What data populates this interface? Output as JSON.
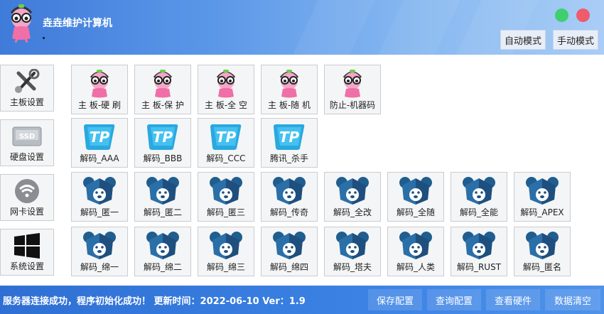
{
  "header": {
    "title": "垚垚维护计算机",
    "auto_mode_label": "自动模式",
    "manual_mode_label": "手动模式",
    "close_color": "#ef5a6d",
    "min_color": "#3fcf6f"
  },
  "sidebar": {
    "items": [
      {
        "label": "主板设置",
        "icon": "tools-icon"
      },
      {
        "label": "硬盘设置",
        "icon": "ssd-icon"
      },
      {
        "label": "网卡设置",
        "icon": "wifi-icon"
      },
      {
        "label": "系统设置",
        "icon": "windows-icon"
      }
    ]
  },
  "rows": [
    {
      "icon": "mascot-icon",
      "tiles": [
        "主 板-硬 刷",
        "主 板-保 护",
        "主 板-全 空",
        "主 板-随 机",
        "防止-机器码"
      ]
    },
    {
      "icon": "tp-icon",
      "tiles": [
        "解码_AAA",
        "解码_BBB",
        "解码_CCC",
        "腾讯_杀手"
      ]
    },
    {
      "icon": "bear-icon",
      "tiles": [
        "解码_匿一",
        "解码_匿二",
        "解码_匿三",
        "解码_传奇",
        "解码_全改",
        "解码_全随",
        "解码_全能",
        "解码_APEX"
      ]
    },
    {
      "icon": "bear-icon",
      "tiles": [
        "解码_绵一",
        "解码_绵二",
        "解码_绵三",
        "解码_绵四",
        "解码_塔夫",
        "解码_人类",
        "解码_RUST",
        "解码_匿名"
      ]
    }
  ],
  "status": {
    "text": "服务器连接成功，程序初始化成功！  更新时间：2022-06-10  Ver：1.9",
    "buttons": [
      "保存配置",
      "查询配置",
      "查看硬件",
      "数据清空"
    ]
  }
}
